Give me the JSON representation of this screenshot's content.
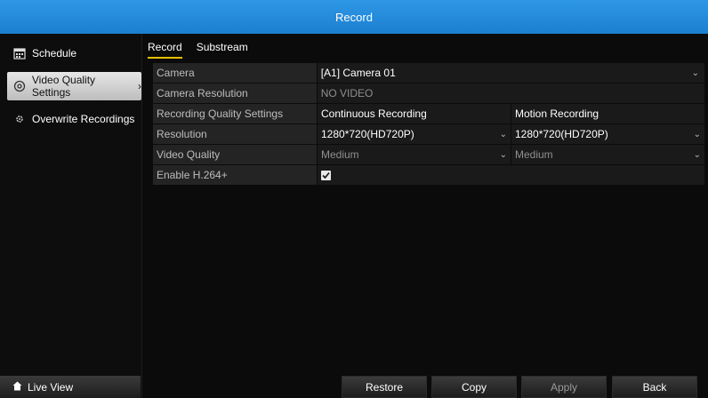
{
  "title": "Record",
  "sidebar": {
    "items": [
      {
        "label": "Schedule",
        "icon": "calendar-icon"
      },
      {
        "label": "Video Quality Settings",
        "icon": "gear-icon"
      },
      {
        "label": "Overwrite Recordings",
        "icon": "cog-icon"
      }
    ],
    "live_view": "Live View"
  },
  "tabs": [
    {
      "label": "Record",
      "active": true
    },
    {
      "label": "Substream",
      "active": false
    }
  ],
  "rows": {
    "camera": {
      "label": "Camera",
      "value": "[A1] Camera 01"
    },
    "resolution_cam": {
      "label": "Camera Resolution",
      "value": "NO VIDEO"
    },
    "quality_settings": {
      "label": "Recording Quality Settings",
      "continuous": "Continuous Recording",
      "motion": "Motion Recording"
    },
    "resolution": {
      "label": "Resolution",
      "continuous": "1280*720(HD720P)",
      "motion": "1280*720(HD720P)"
    },
    "video_quality": {
      "label": "Video Quality",
      "continuous": "Medium",
      "motion": "Medium"
    },
    "h264": {
      "label": "Enable H.264+",
      "checked": true
    }
  },
  "buttons": {
    "restore": "Restore",
    "copy": "Copy",
    "apply": "Apply",
    "back": "Back"
  },
  "colors": {
    "titlebar": "#2389dc",
    "tab_underline": "#e6c000"
  }
}
